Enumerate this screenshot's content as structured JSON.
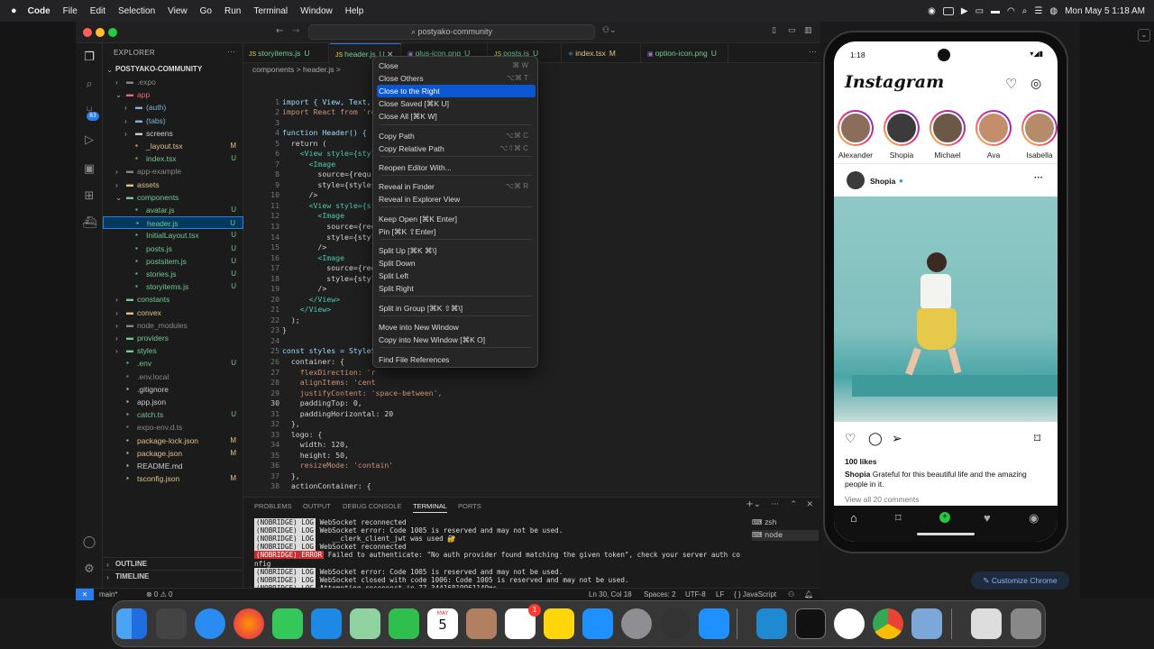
{
  "menubar": {
    "app_name": "Code",
    "items": [
      "File",
      "Edit",
      "Selection",
      "View",
      "Go",
      "Run",
      "Terminal",
      "Window",
      "Help"
    ],
    "clock": "Mon May 5  1:18 AM"
  },
  "vscode": {
    "command_center": "postyako-community",
    "explorer_title": "EXPLORER",
    "project": "POSTYAKO-COMMUNITY",
    "tree": [
      {
        "name": ".expo",
        "depth": 1,
        "color": "#888",
        "badge": ""
      },
      {
        "name": "app",
        "depth": 1,
        "color": "#e06c75",
        "badge": ""
      },
      {
        "name": "(auth)",
        "depth": 2,
        "color": "#7fb3d5",
        "badge": ""
      },
      {
        "name": "(tabs)",
        "depth": 2,
        "color": "#7fb3d5",
        "badge": ""
      },
      {
        "name": "screens",
        "depth": 2,
        "color": "#ccc",
        "badge": ""
      },
      {
        "name": "_layout.tsx",
        "depth": 2,
        "color": "#e2c08d",
        "badge": "M"
      },
      {
        "name": "index.tsx",
        "depth": 2,
        "color": "#73c991",
        "badge": "U"
      },
      {
        "name": "app-example",
        "depth": 1,
        "color": "#888",
        "badge": ""
      },
      {
        "name": "assets",
        "depth": 1,
        "color": "#e2c08d",
        "badge": ""
      },
      {
        "name": "components",
        "depth": 1,
        "color": "#73c991",
        "badge": ""
      },
      {
        "name": "avatar.js",
        "depth": 2,
        "color": "#73c991",
        "badge": "U"
      },
      {
        "name": "header.js",
        "depth": 2,
        "color": "#73c991",
        "badge": "U"
      },
      {
        "name": "InitialLayout.tsx",
        "depth": 2,
        "color": "#73c991",
        "badge": "U"
      },
      {
        "name": "posts.js",
        "depth": 2,
        "color": "#73c991",
        "badge": "U"
      },
      {
        "name": "postsitem.js",
        "depth": 2,
        "color": "#73c991",
        "badge": "U"
      },
      {
        "name": "stories.js",
        "depth": 2,
        "color": "#73c991",
        "badge": "U"
      },
      {
        "name": "storyitems.js",
        "depth": 2,
        "color": "#73c991",
        "badge": "U"
      },
      {
        "name": "constants",
        "depth": 1,
        "color": "#73c991",
        "badge": ""
      },
      {
        "name": "convex",
        "depth": 1,
        "color": "#e2c08d",
        "badge": ""
      },
      {
        "name": "node_modules",
        "depth": 1,
        "color": "#888",
        "badge": ""
      },
      {
        "name": "providers",
        "depth": 1,
        "color": "#73c991",
        "badge": ""
      },
      {
        "name": "styles",
        "depth": 1,
        "color": "#73c991",
        "badge": ""
      },
      {
        "name": ".env",
        "depth": 1,
        "color": "#73c991",
        "badge": "U"
      },
      {
        "name": ".env.local",
        "depth": 1,
        "color": "#888",
        "badge": ""
      },
      {
        "name": ".gitignore",
        "depth": 1,
        "color": "#ccc",
        "badge": ""
      },
      {
        "name": "app.json",
        "depth": 1,
        "color": "#ccc",
        "badge": ""
      },
      {
        "name": "catch.ts",
        "depth": 1,
        "color": "#73c991",
        "badge": "U"
      },
      {
        "name": "expo-env.d.ts",
        "depth": 1,
        "color": "#888",
        "badge": ""
      },
      {
        "name": "package-lock.json",
        "depth": 1,
        "color": "#e2c08d",
        "badge": "M"
      },
      {
        "name": "package.json",
        "depth": 1,
        "color": "#e2c08d",
        "badge": "M"
      },
      {
        "name": "README.md",
        "depth": 1,
        "color": "#ccc",
        "badge": ""
      },
      {
        "name": "tsconfig.json",
        "depth": 1,
        "color": "#e2c08d",
        "badge": "M"
      }
    ],
    "outline": "OUTLINE",
    "timeline": "TIMELINE",
    "tabs": [
      {
        "name": "storyitems.js",
        "badge": "U"
      },
      {
        "name": "header.js",
        "badge": "U"
      },
      {
        "name": "plus-icon.png",
        "badge": "U"
      },
      {
        "name": "posts.js",
        "badge": "U"
      },
      {
        "name": "index.tsx",
        "badge": "M"
      },
      {
        "name": "option-icon.png",
        "badge": "U"
      }
    ],
    "breadcrumb": "components  >  header.js  >",
    "line_numbers": [
      "1",
      "2",
      "3",
      "4",
      "5",
      "6",
      "7",
      "8",
      "9",
      "10",
      "11",
      "12",
      "13",
      "14",
      "15",
      "16",
      "17",
      "18",
      "19",
      "20",
      "21",
      "22",
      "23",
      "24",
      "25",
      "26",
      "27",
      "28",
      "29",
      "30",
      "31",
      "32",
      "33",
      "34",
      "35",
      "36",
      "37",
      "38"
    ],
    "code": [
      "import { View, Text, ",
      "import React from 're",
      "",
      "function Header() {",
      "  return (",
      "    <View style={styl",
      "      <Image",
      "        source={requ                             .png\")}",
      "        style={styles",
      "      />",
      "      <View style={st",
      "        <Image",
      "          source={req",
      "          style={styl",
      "        />",
      "        <Image",
      "          source={req                          )}",
      "          style={styl",
      "        />",
      "      </View>",
      "    </View>",
      "  );",
      "}",
      "",
      "const styles = StyleS",
      "  container: {",
      "    flexDirection: 'r",
      "    alignItems: 'cent",
      "    justifyContent: 'space-between',",
      "    paddingTop: 0,",
      "    paddingHorizontal: 20",
      "  },",
      "  logo: {",
      "    width: 120,",
      "    height: 50,",
      "    resizeMode: 'contain'",
      "  },",
      "  actionContainer: {"
    ],
    "panel_tabs": [
      "PROBLEMS",
      "OUTPUT",
      "DEBUG CONSOLE",
      "TERMINAL",
      "PORTS"
    ],
    "terminal_lines": [
      {
        "tag": "(NOBRIDGE) LOG",
        "text": " WebSocket reconnected",
        "err": false
      },
      {
        "tag": "(NOBRIDGE) LOG",
        "text": " WebSocket error: Code 1005 is reserved and may not be used.",
        "err": false
      },
      {
        "tag": "(NOBRIDGE) LOG",
        "text": "    __clerk_client_jwt was used 🔐",
        "err": false
      },
      {
        "tag": "(NOBRIDGE) LOG",
        "text": " WebSocket reconnected",
        "err": false
      },
      {
        "tag": "(NOBRIDGE) ERROR",
        "text": " Failed to authenticate: \"No auth provider found matching the given token\", check your server auth co",
        "err": true
      },
      {
        "tag": "",
        "text": "nfig",
        "err": false
      },
      {
        "tag": "(NOBRIDGE) LOG",
        "text": " WebSocket error: Code 1005 is reserved and may not be used.",
        "err": false
      },
      {
        "tag": "(NOBRIDGE) LOG",
        "text": " WebSocket closed with code 1006: Code 1005 is reserved and may not be used.",
        "err": false
      },
      {
        "tag": "(NOBRIDGE) LOG",
        "text": " Attempting reconnect in 77.34416819961149ms",
        "err": false
      },
      {
        "tag": "(NOBRIDGE) LOG",
        "text": " WebSocket reconnected",
        "err": false
      }
    ],
    "terminal_sessions": [
      "zsh",
      "node"
    ],
    "status": {
      "branch": "main*",
      "errors": "⊗ 0 ⚠ 0",
      "position": "Ln 30, Col 18",
      "spaces": "Spaces: 2",
      "encoding": "UTF-8",
      "eol": "LF",
      "language": "{ } JavaScript"
    }
  },
  "context_menu": [
    {
      "label": "Close",
      "key": "⌘ W",
      "hl": false
    },
    {
      "label": "Close Others",
      "key": "⌥⌘ T",
      "hl": false
    },
    {
      "label": "Close to the Right",
      "key": "",
      "hl": true
    },
    {
      "label": "Close Saved [⌘K U]",
      "key": "",
      "hl": false
    },
    {
      "label": "Close All [⌘K W]",
      "key": "",
      "hl": false
    },
    {
      "label": "Copy Path",
      "key": "⌥⌘ C",
      "hl": false
    },
    {
      "label": "Copy Relative Path",
      "key": "⌥⇧⌘ C",
      "hl": false
    },
    {
      "label": "Reopen Editor With...",
      "key": "",
      "hl": false
    },
    {
      "label": "Reveal in Finder",
      "key": "⌥⌘ R",
      "hl": false
    },
    {
      "label": "Reveal in Explorer View",
      "key": "",
      "hl": false
    },
    {
      "label": "Keep Open [⌘K Enter]",
      "key": "",
      "hl": false
    },
    {
      "label": "Pin [⌘K ⇧Enter]",
      "key": "",
      "hl": false
    },
    {
      "label": "Split Up [⌘K ⌘\\]",
      "key": "",
      "hl": false
    },
    {
      "label": "Split Down",
      "key": "",
      "hl": false
    },
    {
      "label": "Split Left",
      "key": "",
      "hl": false
    },
    {
      "label": "Split Right",
      "key": "",
      "hl": false
    },
    {
      "label": "Split in Group [⌘K ⇧⌘\\]",
      "key": "",
      "hl": false
    },
    {
      "label": "Move into New Window",
      "key": "",
      "hl": false
    },
    {
      "label": "Copy into New Window [⌘K O]",
      "key": "",
      "hl": false
    },
    {
      "label": "Find File References",
      "key": "",
      "hl": false
    }
  ],
  "phone": {
    "time": "1:18",
    "app_title": "Instagram",
    "stories": [
      {
        "name": "Alexander",
        "color": "#8a6d5a"
      },
      {
        "name": "Shopia",
        "color": "#3b3b3b"
      },
      {
        "name": "Michael",
        "color": "#6b5847"
      },
      {
        "name": "Ava",
        "color": "#c48d6c"
      },
      {
        "name": "Isabella",
        "color": "#b58b6a"
      }
    ],
    "post_user": "Shopia",
    "likes": "100 likes",
    "caption_user": "Shopia",
    "caption": "Grateful for this beautiful life and the amazing people in it.",
    "comments": "View all 20 comments"
  },
  "customize_chrome": "Customize Chrome",
  "dock_badge": "1",
  "calendar_month": "MAY",
  "calendar_day": "5"
}
